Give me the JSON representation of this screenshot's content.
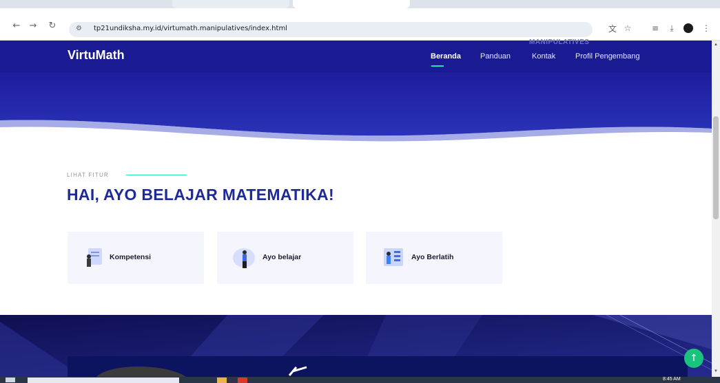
{
  "browser": {
    "url": "tp21undiksha.my.id/virtumath.manipulatives/index.html",
    "icons": [
      "back-icon",
      "forward-icon",
      "reload-icon",
      "site-info-icon",
      "translate-icon",
      "bookmark-star-icon",
      "reading-list-icon",
      "download-icon",
      "profile-icon",
      "more-icon"
    ]
  },
  "site": {
    "brand": "VirtuMath",
    "nav": [
      "Beranda",
      "Panduan",
      "Kontak",
      "Profil Pengembang"
    ],
    "nav_active": "Beranda",
    "ghost_text": "MANIPULATIVES"
  },
  "section": {
    "eyebrow": "LIHAT FITUR",
    "title": "HAI, AYO BELAJAR MATEMATIKA!",
    "cards": [
      {
        "label": "Kompetensi",
        "icon": "competency-icon"
      },
      {
        "label": "Ayo belajar",
        "icon": "learning-icon"
      },
      {
        "label": "Ayo Berlatih",
        "icon": "practice-icon"
      }
    ]
  },
  "system": {
    "clock": "8:45 AM"
  },
  "colors": {
    "header": "#1a1a93",
    "accent": "#1de9b6",
    "title": "#1f2a9a",
    "card_bg": "#f5f6fd",
    "to_top": "#19c37d"
  }
}
